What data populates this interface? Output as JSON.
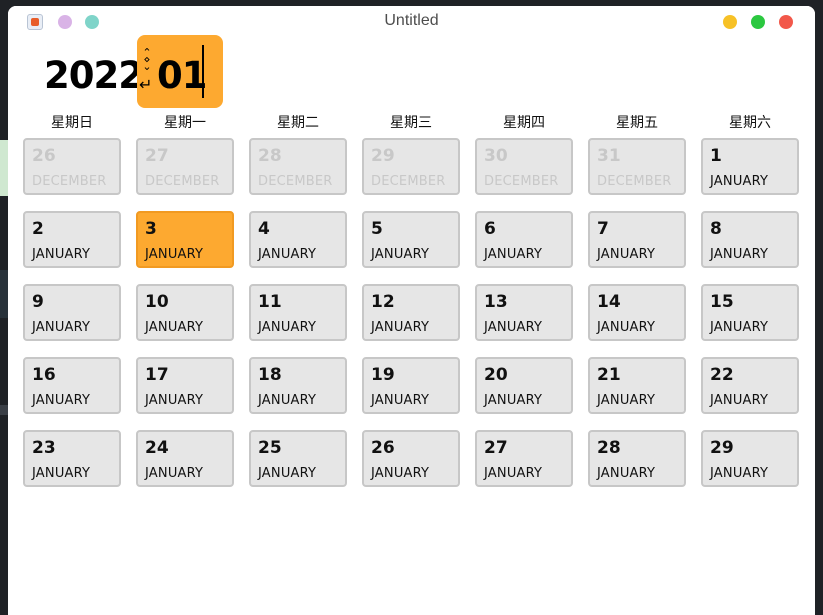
{
  "window": {
    "title": "Untitled"
  },
  "colors": {
    "accent": "#fda930",
    "cell_bg": "#e6e6e6",
    "cell_border": "#c7c7c7",
    "muted_text": "#c8c8c8",
    "dot_purple": "#d9b3e6",
    "dot_teal": "#7fd4c9",
    "btn_minimize": "#f7c126",
    "btn_maximize": "#2bc840",
    "btn_close": "#f2584a"
  },
  "header": {
    "year": "2022",
    "month": "01",
    "spin_glyph": "⋄",
    "enter_glyph": "↵"
  },
  "weekdays": [
    "星期日",
    "星期一",
    "星期二",
    "星期三",
    "星期四",
    "星期五",
    "星期六"
  ],
  "weeks": [
    [
      {
        "day": "26",
        "month": "DECEMBER",
        "muted": true
      },
      {
        "day": "27",
        "month": "DECEMBER",
        "muted": true
      },
      {
        "day": "28",
        "month": "DECEMBER",
        "muted": true
      },
      {
        "day": "29",
        "month": "DECEMBER",
        "muted": true
      },
      {
        "day": "30",
        "month": "DECEMBER",
        "muted": true
      },
      {
        "day": "31",
        "month": "DECEMBER",
        "muted": true
      },
      {
        "day": "1",
        "month": "JANUARY",
        "muted": false
      }
    ],
    [
      {
        "day": "2",
        "month": "JANUARY",
        "muted": false
      },
      {
        "day": "3",
        "month": "JANUARY",
        "muted": false,
        "selected": true
      },
      {
        "day": "4",
        "month": "JANUARY",
        "muted": false
      },
      {
        "day": "5",
        "month": "JANUARY",
        "muted": false
      },
      {
        "day": "6",
        "month": "JANUARY",
        "muted": false
      },
      {
        "day": "7",
        "month": "JANUARY",
        "muted": false
      },
      {
        "day": "8",
        "month": "JANUARY",
        "muted": false
      }
    ],
    [
      {
        "day": "9",
        "month": "JANUARY",
        "muted": false
      },
      {
        "day": "10",
        "month": "JANUARY",
        "muted": false
      },
      {
        "day": "11",
        "month": "JANUARY",
        "muted": false
      },
      {
        "day": "12",
        "month": "JANUARY",
        "muted": false
      },
      {
        "day": "13",
        "month": "JANUARY",
        "muted": false
      },
      {
        "day": "14",
        "month": "JANUARY",
        "muted": false
      },
      {
        "day": "15",
        "month": "JANUARY",
        "muted": false
      }
    ],
    [
      {
        "day": "16",
        "month": "JANUARY",
        "muted": false
      },
      {
        "day": "17",
        "month": "JANUARY",
        "muted": false
      },
      {
        "day": "18",
        "month": "JANUARY",
        "muted": false
      },
      {
        "day": "19",
        "month": "JANUARY",
        "muted": false
      },
      {
        "day": "20",
        "month": "JANUARY",
        "muted": false
      },
      {
        "day": "21",
        "month": "JANUARY",
        "muted": false
      },
      {
        "day": "22",
        "month": "JANUARY",
        "muted": false
      }
    ],
    [
      {
        "day": "23",
        "month": "JANUARY",
        "muted": false
      },
      {
        "day": "24",
        "month": "JANUARY",
        "muted": false
      },
      {
        "day": "25",
        "month": "JANUARY",
        "muted": false
      },
      {
        "day": "26",
        "month": "JANUARY",
        "muted": false
      },
      {
        "day": "27",
        "month": "JANUARY",
        "muted": false
      },
      {
        "day": "28",
        "month": "JANUARY",
        "muted": false
      },
      {
        "day": "29",
        "month": "JANUARY",
        "muted": false
      }
    ]
  ]
}
